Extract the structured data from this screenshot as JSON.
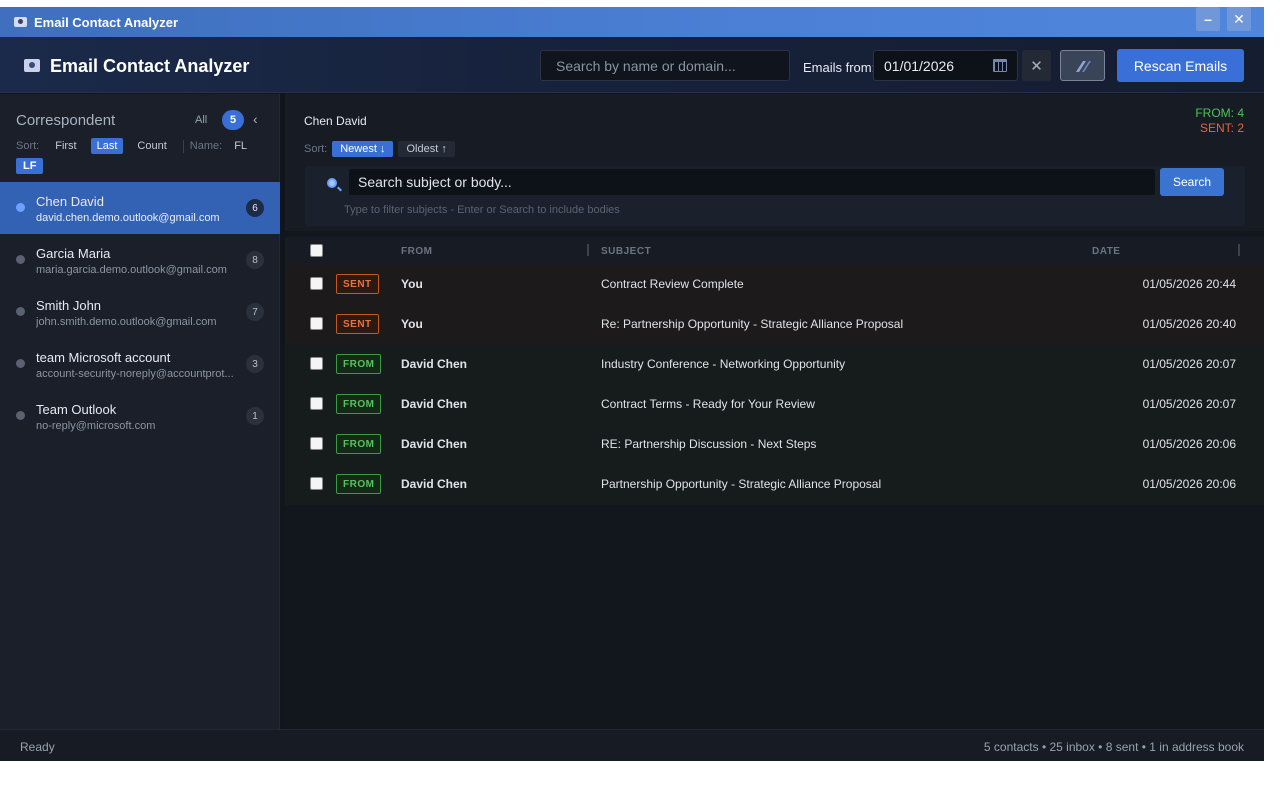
{
  "window": {
    "title": "Email Contact Analyzer",
    "minimize": "–",
    "close": "✕"
  },
  "header": {
    "title": "Email Contact Analyzer",
    "search_placeholder": "Search by name or domain...",
    "emails_from_label": "Emails from:",
    "date_value": "01/01/2026",
    "clear_label": "✕",
    "rescan_label": "Rescan Emails"
  },
  "sidebar": {
    "title": "Correspondent",
    "all_label": "All",
    "count": "5",
    "collapse": "‹",
    "sort_label": "Sort:",
    "sort_options": [
      "First",
      "Last",
      "Count"
    ],
    "sort_active": "Last",
    "name_label": "Name:",
    "name_options": [
      "FL",
      "LF"
    ],
    "name_active": "LF",
    "contacts": [
      {
        "name": "Chen David",
        "email": "david.chen.demo.outlook@gmail.com",
        "count": "6",
        "active": true
      },
      {
        "name": "Garcia Maria",
        "email": "maria.garcia.demo.outlook@gmail.com",
        "count": "8",
        "active": false
      },
      {
        "name": "Smith John",
        "email": "john.smith.demo.outlook@gmail.com",
        "count": "7",
        "active": false
      },
      {
        "name": "team Microsoft account",
        "email": "account-security-noreply@accountprot...",
        "count": "3",
        "active": false
      },
      {
        "name": "Team Outlook",
        "email": "no-reply@microsoft.com",
        "count": "1",
        "active": false
      }
    ]
  },
  "main": {
    "contact_name": "Chen David",
    "from_stat": "FROM: 4",
    "sent_stat": "SENT: 2",
    "sort_label": "Sort:",
    "sort_newest": "Newest ↓",
    "sort_oldest": "Oldest ↑",
    "search_placeholder": "Search subject or body...",
    "search_button": "Search",
    "search_hint": "Type to filter subjects - Enter or Search to include bodies",
    "columns": {
      "from": "FROM",
      "subject": "SUBJECT",
      "date": "DATE"
    },
    "emails": [
      {
        "type": "sent",
        "tag": "SENT",
        "from": "You",
        "subject": "Contract Review Complete",
        "date": "01/05/2026 20:44"
      },
      {
        "type": "sent",
        "tag": "SENT",
        "from": "You",
        "subject": "Re: Partnership Opportunity - Strategic Alliance Proposal",
        "date": "01/05/2026 20:40"
      },
      {
        "type": "from",
        "tag": "FROM",
        "from": "David Chen",
        "subject": "Industry Conference - Networking Opportunity",
        "date": "01/05/2026 20:07"
      },
      {
        "type": "from",
        "tag": "FROM",
        "from": "David Chen",
        "subject": "Contract Terms - Ready for Your Review",
        "date": "01/05/2026 20:07"
      },
      {
        "type": "from",
        "tag": "FROM",
        "from": "David Chen",
        "subject": "RE: Partnership Discussion - Next Steps",
        "date": "01/05/2026 20:06"
      },
      {
        "type": "from",
        "tag": "FROM",
        "from": "David Chen",
        "subject": "Partnership Opportunity - Strategic Alliance Proposal",
        "date": "01/05/2026 20:06"
      }
    ]
  },
  "status": {
    "left": "Ready",
    "right": "5 contacts • 25 inbox • 8 sent • 1 in address book"
  },
  "colors": {
    "accent": "#3a70d6",
    "from_green": "#4fc35c",
    "sent_orange": "#e0683b"
  }
}
